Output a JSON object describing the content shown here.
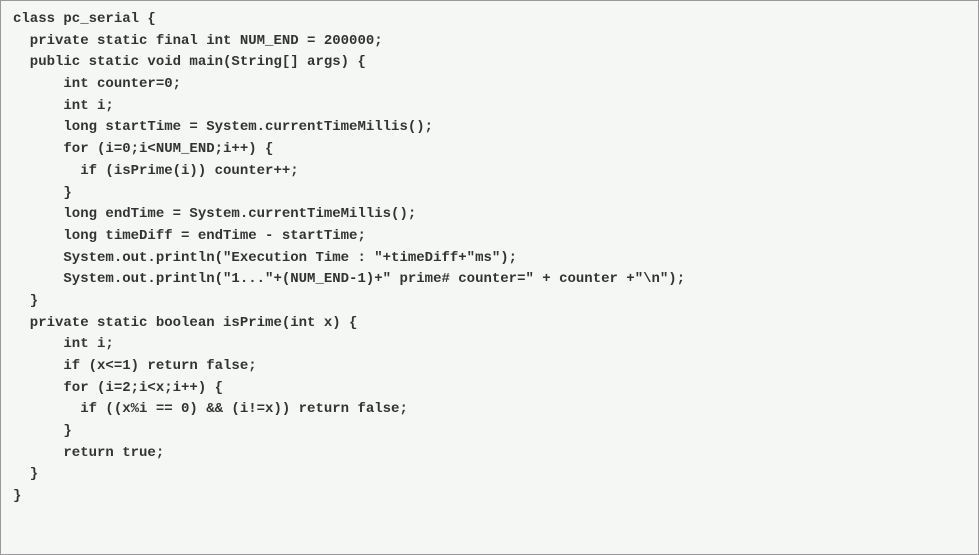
{
  "code": {
    "lines": [
      "class pc_serial {",
      "  private static final int NUM_END = 200000;",
      "  public static void main(String[] args) {",
      "      int counter=0;",
      "      int i;",
      "",
      "      long startTime = System.currentTimeMillis();",
      "      for (i=0;i<NUM_END;i++) {",
      "        if (isPrime(i)) counter++;",
      "      }",
      "      long endTime = System.currentTimeMillis();",
      "      long timeDiff = endTime - startTime;",
      "      System.out.println(\"Execution Time : \"+timeDiff+\"ms\");",
      "      System.out.println(\"1...\"+(NUM_END-1)+\" prime# counter=\" + counter +\"\\n\");",
      "  }",
      "",
      "  private static boolean isPrime(int x) {",
      "      int i;",
      "      if (x<=1) return false;",
      "      for (i=2;i<x;i++) {",
      "        if ((x%i == 0) && (i!=x)) return false;",
      "      }",
      "      return true;",
      "  }",
      "}"
    ]
  }
}
